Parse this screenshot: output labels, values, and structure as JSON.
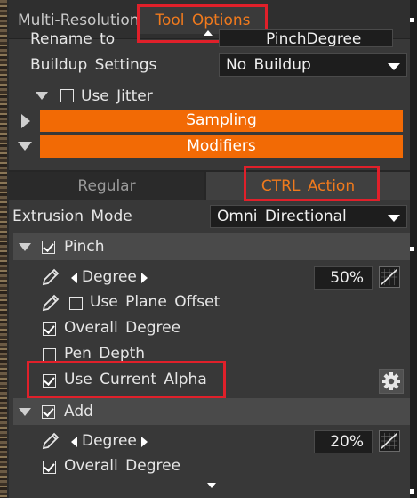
{
  "tabs": {
    "multi_resolution": "Multi-Resolution",
    "tool_options": "Tool Options"
  },
  "rename": {
    "label": "Rename to",
    "value": "PinchDegree"
  },
  "buildup": {
    "label": "Buildup Settings",
    "value": "No Buildup"
  },
  "use_jitter": {
    "label": "Use Jitter",
    "checked": false
  },
  "sampling_label": "Sampling",
  "modifiers_label": "Modifiers",
  "subtabs": {
    "regular": "Regular",
    "ctrl_action": "CTRL Action"
  },
  "extrusion": {
    "label": "Extrusion Mode",
    "value": "Omni Directional"
  },
  "pinch": {
    "label": "Pinch",
    "checked": true,
    "degree_label": "Degree",
    "degree_value": "50%",
    "use_plane_offset": "Use Plane Offset",
    "overall_degree": "Overall Degree",
    "pen_depth": "Pen Depth",
    "use_current_alpha": "Use Current Alpha"
  },
  "add": {
    "label": "Add",
    "checked": true,
    "degree_label": "Degree",
    "degree_value": "20%",
    "overall_degree": "Overall Degree"
  },
  "colors": {
    "accent_orange": "#f26a05",
    "tab_active_text": "#f07a1d",
    "highlight_red": "#e0202a",
    "panel_bg": "#383838"
  },
  "icons": [
    "pen-icon",
    "curve-icon",
    "gear-icon",
    "checkbox-icon",
    "chevron-down-icon",
    "chevron-right-icon"
  ]
}
